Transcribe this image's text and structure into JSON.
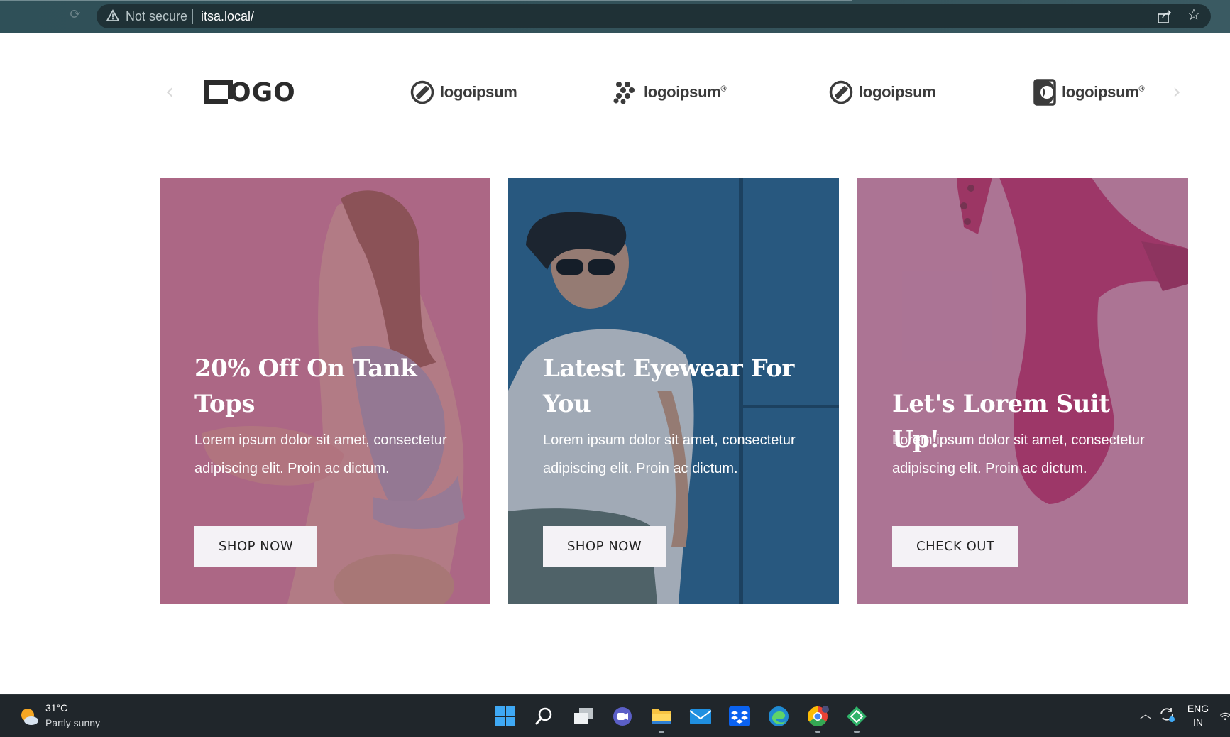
{
  "browser": {
    "security_label": "Not secure",
    "url": "itsa.local/"
  },
  "logo_carousel": {
    "logos": [
      {
        "text": "OGO",
        "icon": "logo-square-l-icon"
      },
      {
        "text": "logoipsum",
        "icon": "logoipsum-leaf-icon"
      },
      {
        "text": "logoipsum",
        "icon": "logoipsum-dots-icon",
        "registered": "®"
      },
      {
        "text": "logoipsum",
        "icon": "logoipsum-leaf-icon"
      },
      {
        "text": "logoipsum",
        "icon": "logoipsum-halfmoon-icon",
        "registered": "®"
      }
    ]
  },
  "promo_cards": [
    {
      "title": "20% Off On Tank Tops",
      "description": "Lorem ipsum dolor sit amet, consectetur adipiscing elit. Proin ac dictum.",
      "button_label": "SHOP NOW"
    },
    {
      "title": "Latest Eyewear For You",
      "description": "Lorem ipsum dolor sit amet, consectetur adipiscing elit. Proin ac dictum.",
      "button_label": "SHOP NOW"
    },
    {
      "title": "Let's Lorem Suit Up!",
      "description": "Lorem ipsum dolor sit amet, consectetur adipiscing elit. Proin ac dictum.",
      "button_label": "CHECK OUT"
    }
  ],
  "taskbar": {
    "weather": {
      "temperature": "31°C",
      "condition": "Partly sunny"
    },
    "apps": [
      "windows-start-icon",
      "search-icon",
      "task-view-icon",
      "teams-chat-icon",
      "file-explorer-icon",
      "mail-icon",
      "dropbox-icon",
      "edge-icon",
      "chrome-icon",
      "app-diamond-icon"
    ],
    "language": {
      "line1": "ENG",
      "line2": "IN"
    }
  },
  "colors": {
    "chrome_bg": "#34525a",
    "omnibox_bg": "#1f3136",
    "card_overlay_pink": "#8c4e6c",
    "card_blue": "#2e6a96",
    "button_bg": "#f4f2f6",
    "taskbar_bg": "#20262b"
  }
}
